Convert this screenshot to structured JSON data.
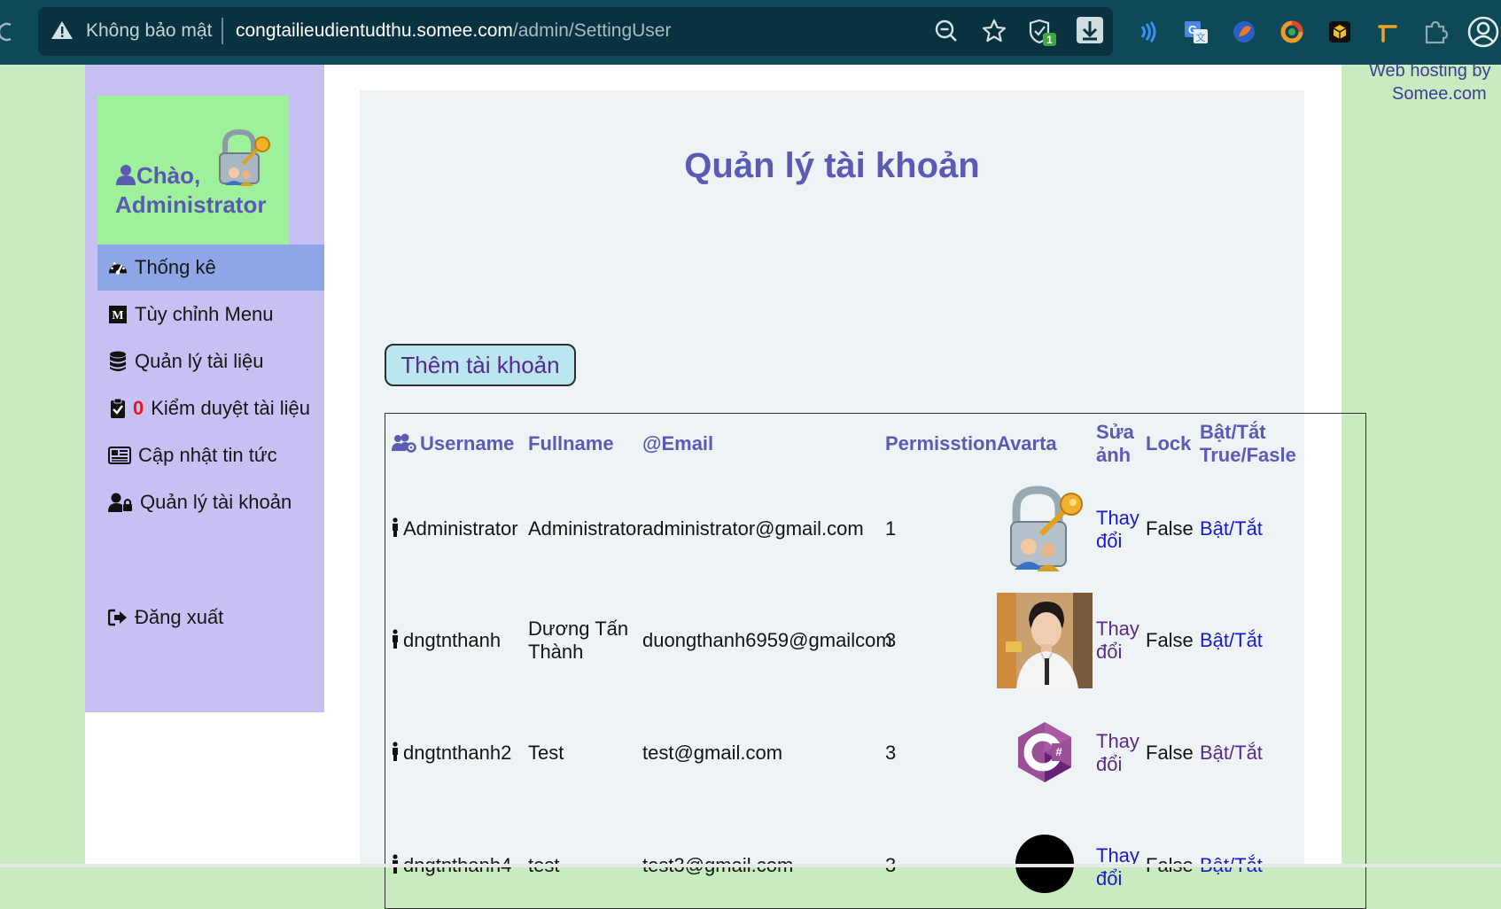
{
  "browser": {
    "security_label": "Không bảo mật",
    "url_host": "congtailieudientudthu.somee.com",
    "url_path": "/admin/SettingUser",
    "shield_badge": "1"
  },
  "hosting": {
    "line1": "Web hosting by",
    "line2": "Somee.com"
  },
  "sidebar": {
    "greeting": "Chào,",
    "user_name": "Administrator",
    "items": [
      {
        "label": "Thống kê",
        "icon": "dashboard-icon"
      },
      {
        "label": "Tùy chỉnh Menu",
        "icon": "medium-icon"
      },
      {
        "label": "Quản lý tài liệu",
        "icon": "database-icon"
      },
      {
        "label": "Kiểm duyệt tài liệu",
        "icon": "clipboard-check-icon",
        "badge": "0"
      },
      {
        "label": "Cập nhật tin tức",
        "icon": "newspaper-icon"
      },
      {
        "label": "Quản lý tài khoản",
        "icon": "user-lock-icon"
      },
      {
        "label": "Đăng xuất",
        "icon": "sign-out-icon"
      }
    ]
  },
  "main": {
    "title": "Quản lý tài khoản",
    "add_button": "Thêm tài khoản",
    "table": {
      "headers": {
        "username": "Username",
        "fullname": "Fullname",
        "email": "@Email",
        "permission": "Permisstion",
        "avatar": "Avarta",
        "edit_image": "Sửa ảnh",
        "lock": "Lock",
        "toggle": "Bật/Tắt True/Fasle"
      },
      "rows": [
        {
          "username": "Administrator",
          "fullname": "Administrator",
          "email": "administrator@gmail.com",
          "permission": "1",
          "avatar": "lock-users-image",
          "edit": "Thay đổi",
          "lock": "False",
          "toggle": "Bật/Tắt"
        },
        {
          "username": "dngtnthanh",
          "fullname": "Dương Tấn Thành",
          "email": "duongthanh6959@gmailcom",
          "permission": "3",
          "avatar": "person-photo",
          "edit": "Thay đổi",
          "lock": "False",
          "toggle": "Bật/Tắt"
        },
        {
          "username": "dngtnthanh2",
          "fullname": "Test",
          "email": "test@gmail.com",
          "permission": "3",
          "avatar": "csharp-logo",
          "edit": "Thay đổi",
          "lock": "False",
          "toggle": "Bật/Tắt"
        },
        {
          "username": "dngtnthanh4",
          "fullname": "test",
          "email": "test3@gmail.com",
          "permission": "3",
          "avatar": "black-circle",
          "edit": "Thay đổi",
          "lock": "False",
          "toggle": "Bật/Tắt"
        }
      ]
    }
  },
  "colors": {
    "chrome": "#0d4957",
    "sidebar": "#c8bff2",
    "active_item": "#8ea6e8",
    "heading": "#5b5bb5",
    "link": "#1a1acc",
    "badge": "#e21a1a"
  }
}
